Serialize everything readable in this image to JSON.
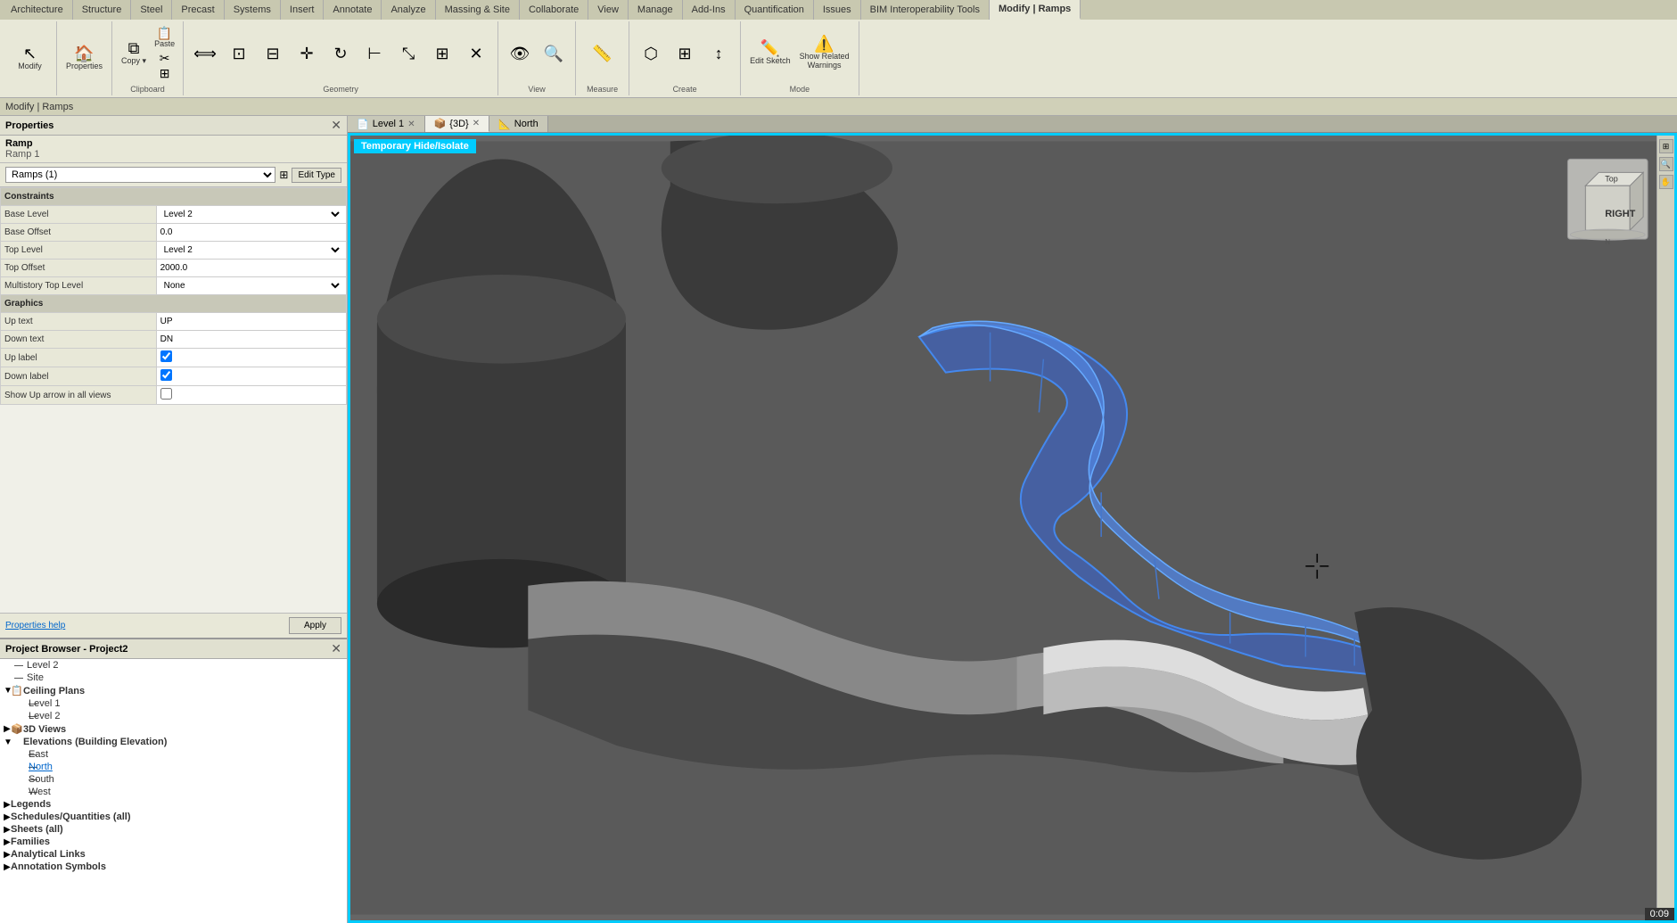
{
  "ribbon": {
    "tabs": [
      "Architecture",
      "Structure",
      "Steel",
      "Precast",
      "Systems",
      "Insert",
      "Annotate",
      "Analyze",
      "Massing & Site",
      "Collaborate",
      "View",
      "Manage",
      "Add-Ins",
      "Quantification",
      "Issues",
      "BIM Interoperability Tools",
      "Modify | Ramps"
    ],
    "active_tab": "Modify | Ramps",
    "groups": {
      "clipboard": {
        "label": "Clipboard",
        "buttons": [
          "Copy",
          "Paste",
          "Cut",
          "Join"
        ]
      },
      "geometry": {
        "label": "Geometry"
      },
      "modify": {
        "label": "Modify"
      },
      "view": {
        "label": "View"
      },
      "measure": {
        "label": "Measure"
      },
      "create": {
        "label": "Create"
      },
      "mode": {
        "label": "Mode",
        "buttons": [
          {
            "label": "Edit Sketch",
            "icon": "✏️"
          },
          {
            "label": "Show Related\nWarnings",
            "icon": "⚠️"
          }
        ]
      },
      "warning": {
        "label": "Warning"
      }
    }
  },
  "breadcrumb": "Modify | Ramps",
  "properties": {
    "panel_title": "Properties",
    "element_type": "Ramp",
    "element_name": "Ramp 1",
    "selector_value": "Ramps (1)",
    "edit_type_label": "Edit Type",
    "sections": [
      {
        "name": "Constraints",
        "rows": [
          {
            "label": "Base Level",
            "value": "Level 2",
            "type": "text"
          },
          {
            "label": "Base Offset",
            "value": "0.0",
            "type": "text"
          },
          {
            "label": "Top Level",
            "value": "Level 2",
            "type": "text"
          },
          {
            "label": "Top Offset",
            "value": "2000.0",
            "type": "text"
          },
          {
            "label": "Multistory Top Level",
            "value": "None",
            "type": "text"
          }
        ]
      },
      {
        "name": "Graphics",
        "rows": [
          {
            "label": "Up text",
            "value": "UP",
            "type": "text"
          },
          {
            "label": "Down text",
            "value": "DN",
            "type": "text"
          },
          {
            "label": "Up label",
            "value": "",
            "type": "checkbox",
            "checked": true
          },
          {
            "label": "Down label",
            "value": "",
            "type": "checkbox",
            "checked": true
          },
          {
            "label": "Show Up arrow in all views",
            "value": "",
            "type": "checkbox",
            "checked": false
          }
        ]
      }
    ],
    "help_link": "Properties help",
    "apply_label": "Apply"
  },
  "project_browser": {
    "title": "Project Browser - Project2",
    "tree": [
      {
        "level": 1,
        "label": "Level 2",
        "toggle": "—",
        "icon": ""
      },
      {
        "level": 1,
        "label": "Site",
        "toggle": "—",
        "icon": ""
      },
      {
        "level": 0,
        "label": "Ceiling Plans",
        "toggle": "▼",
        "icon": "📋",
        "bold": true
      },
      {
        "level": 2,
        "label": "Level 1",
        "toggle": "",
        "icon": ""
      },
      {
        "level": 2,
        "label": "Level 2",
        "toggle": "",
        "icon": ""
      },
      {
        "level": 0,
        "label": "3D Views",
        "toggle": "▶",
        "icon": "📦",
        "bold": true
      },
      {
        "level": 0,
        "label": "Elevations (Building Elevation)",
        "toggle": "▼",
        "icon": "📐",
        "bold": true
      },
      {
        "level": 2,
        "label": "East",
        "toggle": "",
        "icon": ""
      },
      {
        "level": 2,
        "label": "North",
        "toggle": "",
        "icon": "",
        "active": true
      },
      {
        "level": 2,
        "label": "South",
        "toggle": "",
        "icon": ""
      },
      {
        "level": 2,
        "label": "West",
        "toggle": "",
        "icon": ""
      },
      {
        "level": 0,
        "label": "Legends",
        "toggle": "▶",
        "icon": "",
        "bold": true
      },
      {
        "level": 0,
        "label": "Schedules/Quantities (all)",
        "toggle": "▶",
        "icon": "",
        "bold": true
      },
      {
        "level": 0,
        "label": "Sheets (all)",
        "toggle": "▶",
        "icon": "",
        "bold": true
      },
      {
        "level": 0,
        "label": "Families",
        "toggle": "▶",
        "icon": "",
        "bold": true
      },
      {
        "level": 0,
        "label": "Analytical Links",
        "toggle": "▶",
        "icon": "",
        "bold": true
      },
      {
        "level": 0,
        "label": "Annotation Symbols",
        "toggle": "▶",
        "icon": "",
        "bold": true
      }
    ]
  },
  "viewport": {
    "tabs": [
      {
        "label": "Level 1",
        "active": false,
        "closeable": true,
        "icon": "📄"
      },
      {
        "label": "{3D}",
        "active": true,
        "closeable": true,
        "icon": "📦"
      },
      {
        "label": "North",
        "active": false,
        "closeable": false,
        "icon": "📐"
      }
    ],
    "active_view": "{3D}",
    "temp_hide_banner": "Temporary Hide/Isolate",
    "timer": "0:09"
  },
  "colors": {
    "ramp_blue": "#5588cc",
    "ramp_dark": "#555555",
    "ramp_light": "#999999",
    "ramp_highlight": "#4477bb",
    "viewport_bg": "#555555",
    "accent_cyan": "#00ccff"
  }
}
